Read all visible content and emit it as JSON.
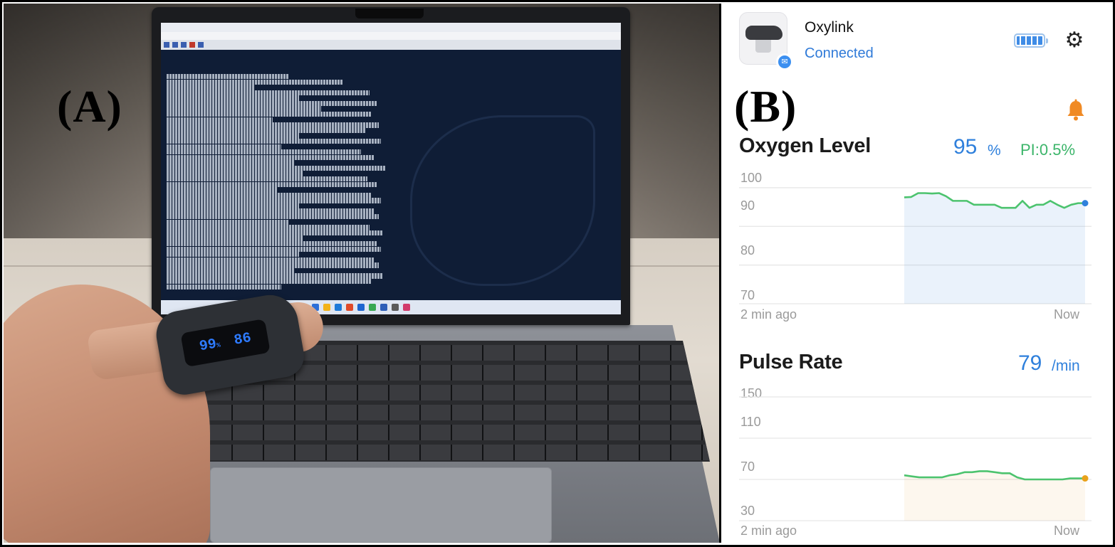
{
  "figure": {
    "panel_a_label": "(A)",
    "panel_b_label": "(B)"
  },
  "photo": {
    "oximeter_spo2": "99",
    "oximeter_unit": "%",
    "oximeter_pulse": "86"
  },
  "app": {
    "device_name": "Oxylink",
    "device_status": "Connected",
    "icons": {
      "bluetooth": "bluetooth-icon",
      "battery": "battery-icon",
      "settings": "gear-icon",
      "alert": "bell-icon"
    },
    "colors": {
      "accent_blue": "#2f80dc",
      "pi_green": "#3cb56a",
      "bell_orange": "#f08a24",
      "spo2_line": "#4cc36e",
      "pulse_line": "#4cc36e",
      "pulse_endpoint": "#e9a21b"
    },
    "oxygen": {
      "title": "Oxygen Level",
      "value": "95",
      "unit": "%",
      "pi": "PI:0.5%",
      "time_start": "2 min ago",
      "time_end": "Now"
    },
    "pulse": {
      "title": "Pulse Rate",
      "value": "79",
      "unit": "/min",
      "time_start": "2 min ago",
      "time_end": "Now"
    }
  },
  "chart_data": [
    {
      "type": "line",
      "y_ticks": [
        100,
        90,
        80,
        70
      ],
      "ylim": [
        70,
        102
      ],
      "x_labels": [
        "2 min ago",
        "Now"
      ],
      "series": [
        {
          "values": [
            97.5,
            97.6,
            98.6,
            98.6,
            98.5,
            98.6,
            97.8,
            96.6,
            96.6,
            96.6,
            95.6,
            95.6,
            95.6,
            95.6,
            94.8,
            94.8,
            94.8,
            96.6,
            94.8,
            95.6,
            95.6,
            96.6,
            95.6,
            94.8,
            95.6,
            96.0,
            96.0
          ]
        }
      ]
    },
    {
      "type": "line",
      "y_ticks": [
        150,
        110,
        70,
        30
      ],
      "ylim": [
        30,
        150
      ],
      "x_labels": [
        "2 min ago",
        "Now"
      ],
      "series": [
        {
          "values": [
            74,
            73,
            72,
            72,
            72,
            72,
            74,
            75,
            77,
            77,
            78,
            78,
            77,
            76,
            76,
            72,
            70,
            70,
            70,
            70,
            70,
            70,
            71,
            71,
            71
          ]
        }
      ]
    }
  ]
}
